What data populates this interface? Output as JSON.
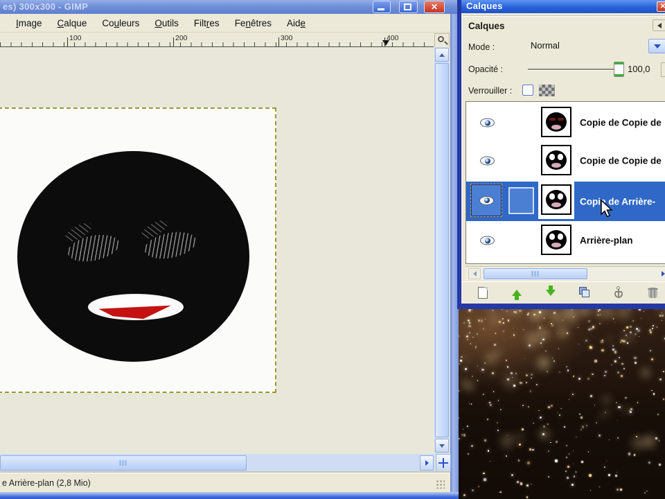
{
  "main_window": {
    "title": "es) 300x300 - GIMP",
    "controls": [
      "minimize",
      "maximize",
      "close"
    ],
    "close_glyph": "✕",
    "menu_items": [
      {
        "label": "Image",
        "mnemonic": 0
      },
      {
        "label": "Calque",
        "mnemonic": 0
      },
      {
        "label": "Couleurs",
        "mnemonic": 2
      },
      {
        "label": "Outils",
        "mnemonic": 0
      },
      {
        "label": "Filtres",
        "mnemonic": 4
      },
      {
        "label": "Fenêtres",
        "mnemonic": 2
      },
      {
        "label": "Aide",
        "mnemonic": 3
      }
    ],
    "ruler_labels": [
      "100",
      "200",
      "300",
      "400"
    ],
    "statusbar_text": "e Arrière-plan (2,8 Mio)"
  },
  "layers_dialog": {
    "window_title": "Calques",
    "close_glyph": "✕",
    "panel_title": "Calques",
    "mode_label": "Mode :",
    "mode_value": "Normal",
    "opacity_label": "Opacité :",
    "opacity_value": "100,0",
    "lock_label": "Verrouiller :",
    "layers": [
      {
        "name": "Copie de Copie de",
        "face": "closed",
        "visible": true,
        "selected": false
      },
      {
        "name": "Copie de Copie de",
        "face": "open",
        "visible": true,
        "selected": false
      },
      {
        "name": "Copie de Arrière-",
        "face": "open",
        "visible": true,
        "selected": true
      },
      {
        "name": "Arrière-plan",
        "face": "open",
        "visible": true,
        "selected": false
      }
    ],
    "toolbar_buttons": [
      "new-layer",
      "raise-layer",
      "lower-layer",
      "duplicate-layer",
      "anchor-layer",
      "delete-layer"
    ]
  },
  "colors": {
    "selection_blue": "#2f68c6",
    "titlebar_active": "#2a62d8",
    "titlebar_inactive": "#718fd8",
    "xp_beige": "#ece9d8",
    "close_red": "#c23523",
    "canvas_surround": "#e8e7da"
  }
}
